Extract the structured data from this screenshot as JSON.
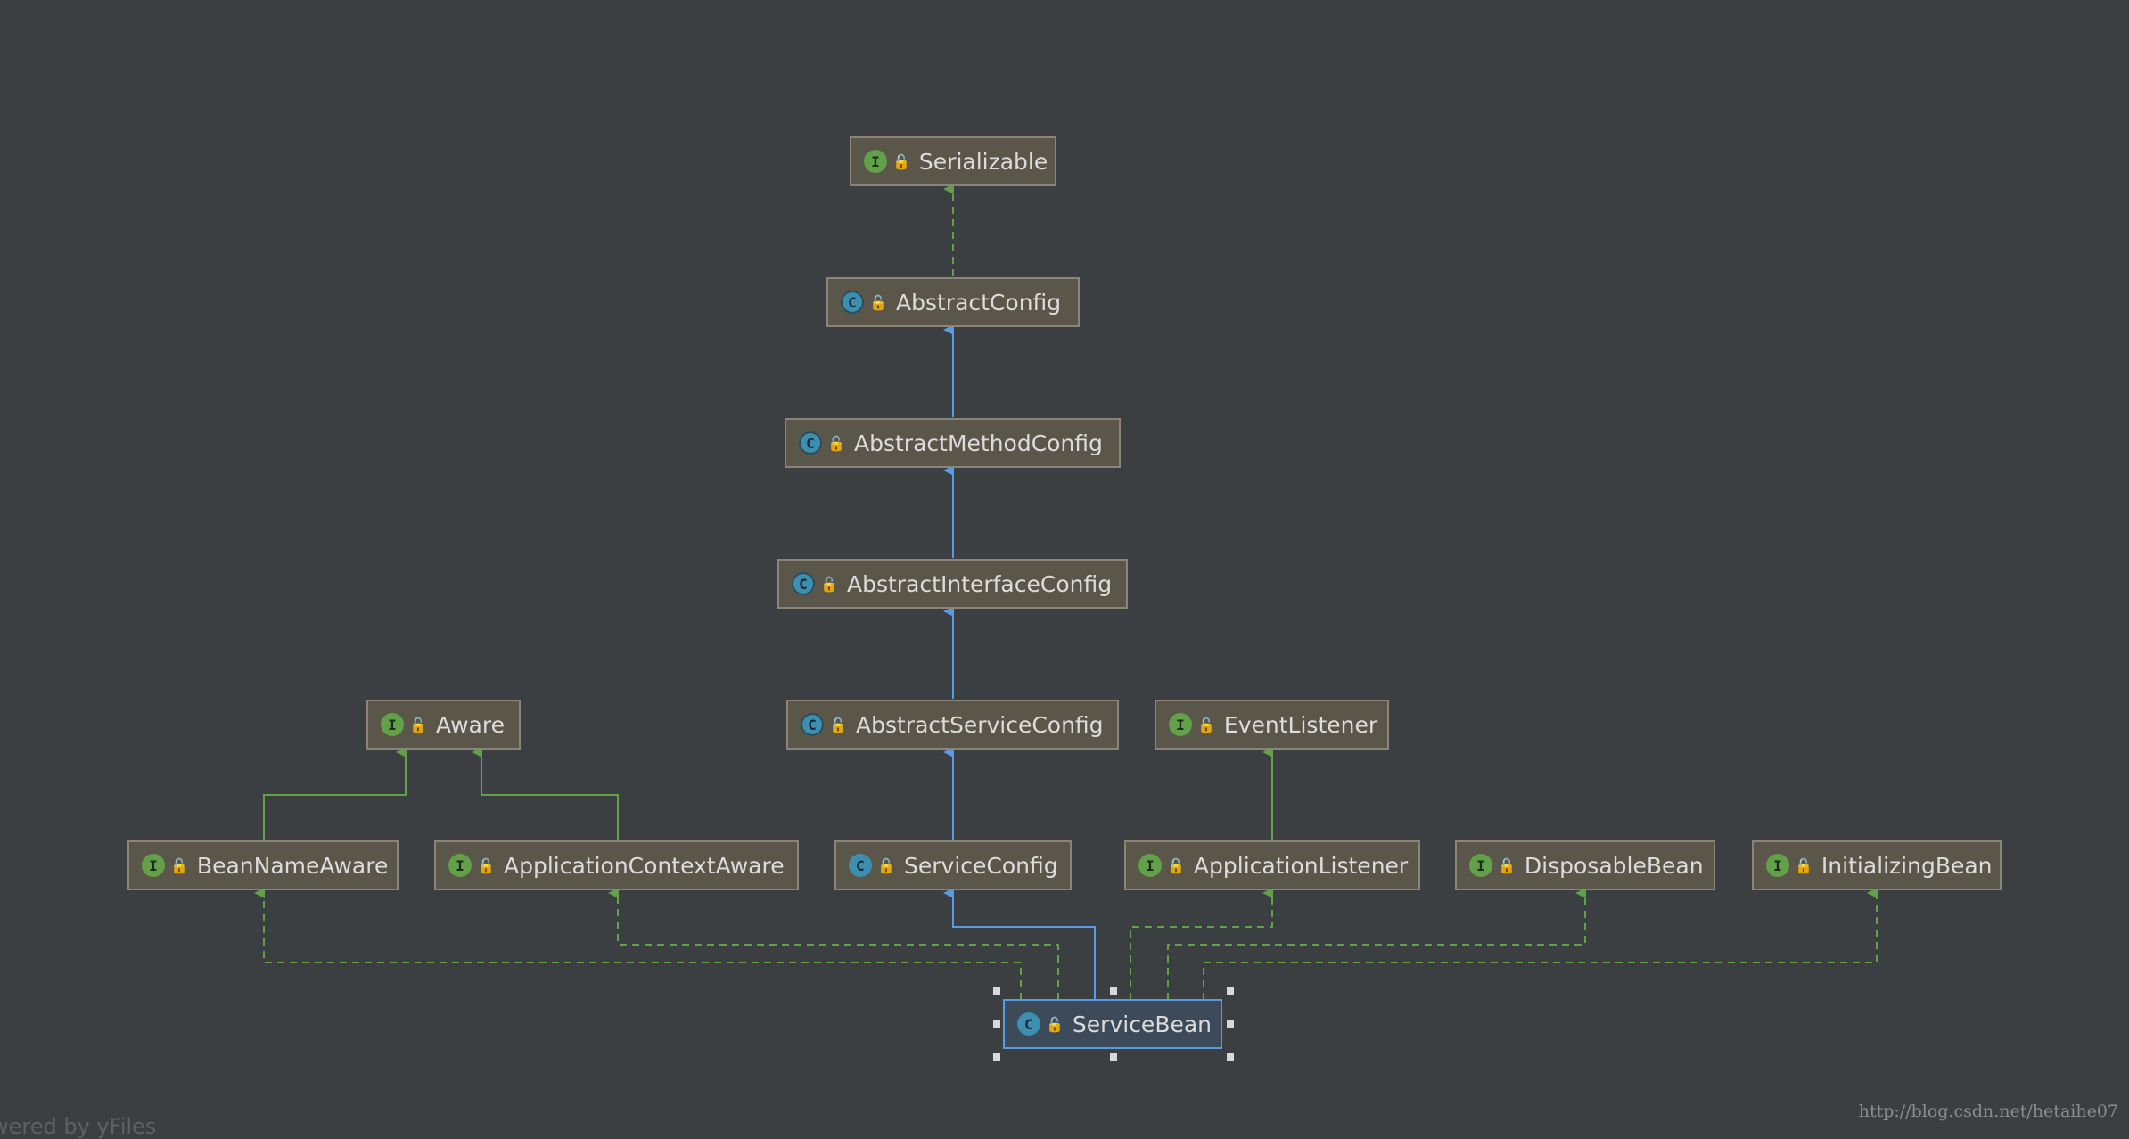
{
  "colors": {
    "background": "#3c3f41",
    "node_fill": "#5b564a",
    "node_border": "#8a8578",
    "extends_edge": "#5a9be6",
    "implements_edge": "#62a04a",
    "selected_border": "#5a9be6"
  },
  "nodes": {
    "serializable": {
      "label": "Serializable",
      "kind": "I",
      "icon": "interface-icon"
    },
    "abstractconfig": {
      "label": "AbstractConfig",
      "kind": "C",
      "icon": "abstract-class-icon"
    },
    "abstractmethod": {
      "label": "AbstractMethodConfig",
      "kind": "C",
      "icon": "abstract-class-icon"
    },
    "abstractinterface": {
      "label": "AbstractInterfaceConfig",
      "kind": "C",
      "icon": "abstract-class-icon"
    },
    "abstractservice": {
      "label": "AbstractServiceConfig",
      "kind": "C",
      "icon": "abstract-class-icon"
    },
    "aware": {
      "label": "Aware",
      "kind": "I",
      "icon": "interface-icon"
    },
    "eventlistener": {
      "label": "EventListener",
      "kind": "I",
      "icon": "interface-icon"
    },
    "beannameaware": {
      "label": "BeanNameAware",
      "kind": "I",
      "icon": "interface-icon"
    },
    "appcontextaware": {
      "label": "ApplicationContextAware",
      "kind": "I",
      "icon": "interface-icon"
    },
    "serviceconfig": {
      "label": "ServiceConfig",
      "kind": "C",
      "icon": "class-icon"
    },
    "applistener": {
      "label": "ApplicationListener",
      "kind": "I",
      "icon": "interface-icon"
    },
    "disposablebean": {
      "label": "DisposableBean",
      "kind": "I",
      "icon": "interface-icon"
    },
    "initializingbean": {
      "label": "InitializingBean",
      "kind": "I",
      "icon": "interface-icon"
    },
    "servicebean": {
      "label": "ServiceBean",
      "kind": "C",
      "icon": "class-icon",
      "selected": true
    }
  },
  "edges": [
    {
      "from": "abstractconfig",
      "to": "serializable",
      "type": "implements"
    },
    {
      "from": "abstractmethod",
      "to": "abstractconfig",
      "type": "extends"
    },
    {
      "from": "abstractinterface",
      "to": "abstractmethod",
      "type": "extends"
    },
    {
      "from": "abstractservice",
      "to": "abstractinterface",
      "type": "extends"
    },
    {
      "from": "serviceconfig",
      "to": "abstractservice",
      "type": "extends"
    },
    {
      "from": "beannameaware",
      "to": "aware",
      "type": "interface-extends"
    },
    {
      "from": "appcontextaware",
      "to": "aware",
      "type": "interface-extends"
    },
    {
      "from": "applistener",
      "to": "eventlistener",
      "type": "interface-extends"
    },
    {
      "from": "servicebean",
      "to": "serviceconfig",
      "type": "extends"
    },
    {
      "from": "servicebean",
      "to": "beannameaware",
      "type": "implements"
    },
    {
      "from": "servicebean",
      "to": "appcontextaware",
      "type": "implements"
    },
    {
      "from": "servicebean",
      "to": "applistener",
      "type": "implements"
    },
    {
      "from": "servicebean",
      "to": "disposablebean",
      "type": "implements"
    },
    {
      "from": "servicebean",
      "to": "initializingbean",
      "type": "implements"
    }
  ],
  "footer": {
    "powered_by": "wered by yFiles",
    "url": "http://blog.csdn.net/hetaihe07"
  }
}
